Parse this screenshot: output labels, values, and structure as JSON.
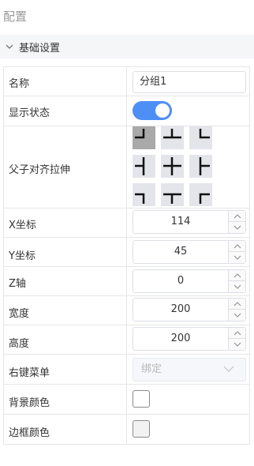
{
  "panel": {
    "title": "配置"
  },
  "section": {
    "title": "基础设置"
  },
  "fields": {
    "name": {
      "label": "名称",
      "value": "分组1"
    },
    "display_state": {
      "label": "显示状态",
      "on": true,
      "accent": "#4d8ff5"
    },
    "stretch": {
      "label": "父子对齐拉伸",
      "selected": "top-left"
    },
    "x": {
      "label": "X坐标",
      "value": "114"
    },
    "y": {
      "label": "Y坐标",
      "value": "45"
    },
    "z": {
      "label": "Z轴",
      "value": "0"
    },
    "width": {
      "label": "宽度",
      "value": "200"
    },
    "height": {
      "label": "高度",
      "value": "200"
    },
    "context_menu": {
      "label": "右键菜单",
      "placeholder": "绑定"
    },
    "bg_color": {
      "label": "背景颜色",
      "value": "#ffffff"
    },
    "border_color": {
      "label": "边框颜色",
      "value": "#f2f2f2"
    }
  }
}
